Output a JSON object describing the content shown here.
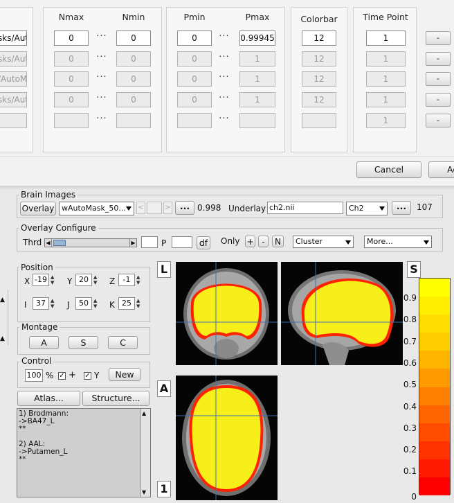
{
  "dialog": {
    "headers": {
      "nmax": "Nmax",
      "nmin": "Nmin",
      "pmin": "Pmin",
      "pmax": "Pmax",
      "colorbar": "Colorbar",
      "timepoint": "Time Point"
    },
    "rows": [
      {
        "mask": "sks/Aut",
        "nmax": "0",
        "nmin": "0",
        "pmin": "0",
        "pmax": "0.99945",
        "colorbar": "12",
        "timepoint": "1",
        "btn": "-"
      },
      {
        "mask": "sks/Aut",
        "nmax": "0",
        "nmin": "0",
        "pmin": "0",
        "pmax": "1",
        "colorbar": "12",
        "timepoint": "1",
        "btn": "-"
      },
      {
        "mask": "/AutoM",
        "nmax": "0",
        "nmin": "0",
        "pmin": "0",
        "pmax": "1",
        "colorbar": "12",
        "timepoint": "1",
        "btn": "-"
      },
      {
        "mask": "sks/Aut",
        "nmax": "0",
        "nmin": "0",
        "pmin": "0",
        "pmax": "1",
        "colorbar": "12",
        "timepoint": "1",
        "btn": "-"
      },
      {
        "mask": "",
        "nmax": "",
        "nmin": "",
        "pmin": "",
        "pmax": "",
        "colorbar": "",
        "timepoint": "1",
        "btn": "-"
      }
    ],
    "dots": "···",
    "cancel": "Cancel",
    "ok": "Ac"
  },
  "brain_images": {
    "title": "Brain Images",
    "overlay_btn": "Overlay",
    "overlay_file": "wAutoMask_50...",
    "browse": "...",
    "overlay_value": "0.998",
    "underlay_label": "Underlay",
    "underlay_file": "ch2.nii",
    "underlay_select": "Ch2",
    "underlay_value": "107"
  },
  "overlay_configure": {
    "title": "Overlay Configure",
    "thrd": "Thrd",
    "p_label": "P",
    "df_btn": "df",
    "only": "Only",
    "plus": "+",
    "minus": "-",
    "n": "N",
    "cluster": "Cluster",
    "more": "More..."
  },
  "position": {
    "title": "Position",
    "x_label": "X",
    "x": "-19",
    "y_label": "Y",
    "y": "20",
    "z_label": "Z",
    "z": "-1",
    "i_label": "I",
    "i": "37",
    "j_label": "J",
    "j": "50",
    "k_label": "K",
    "k": "25"
  },
  "montage": {
    "title": "Montage",
    "a": "A",
    "s": "S",
    "c": "C"
  },
  "control": {
    "title": "Control",
    "percent_value": "100",
    "percent": "%",
    "plus_label": "+",
    "y_label": "Y",
    "new_btn": "New"
  },
  "atlas_btn": "Atlas...",
  "structure_btn": "Structure...",
  "info_text": [
    "1) Brodmann:",
    "->BA47_L",
    "**",
    "",
    "2) AAL:",
    "->Putamen_L",
    "**"
  ],
  "orient_labels": {
    "l": "L",
    "s": "S",
    "a": "A",
    "one": "1"
  },
  "colorbar": {
    "ticks": [
      "0.9",
      "0.8",
      "0.7",
      "0.6",
      "0.5",
      "0.4",
      "0.3",
      "0.2",
      "0.1",
      "0"
    ],
    "colors": [
      "#ffff00",
      "#ffee00",
      "#ffdd00",
      "#ffcc00",
      "#ffb400",
      "#ff9a00",
      "#ff8000",
      "#ff6600",
      "#ff4d00",
      "#ff3300",
      "#ff1a00",
      "#ff0000"
    ]
  }
}
